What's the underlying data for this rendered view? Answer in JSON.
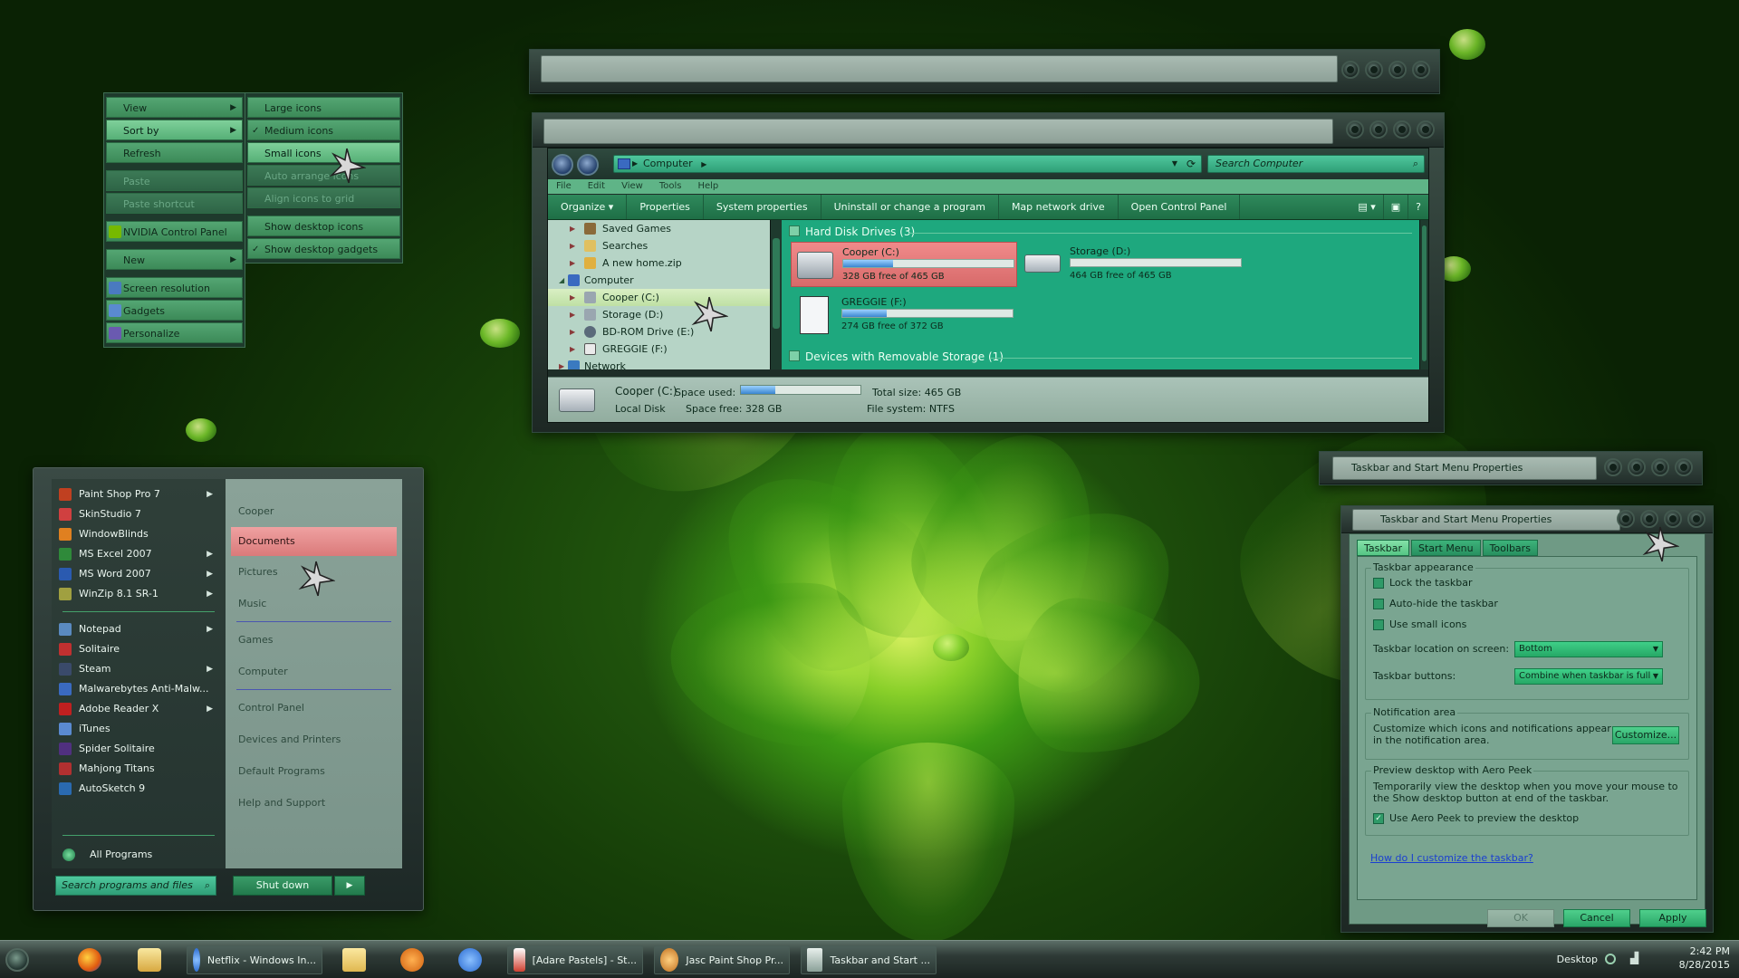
{
  "desktop": {
    "context_menu": {
      "items": [
        {
          "label": "View",
          "state": "normal",
          "submenu": true
        },
        {
          "label": "Sort by",
          "state": "hot",
          "submenu": true
        },
        {
          "label": "Refresh",
          "state": "normal"
        },
        {
          "label": "Paste",
          "state": "disabled"
        },
        {
          "label": "Paste shortcut",
          "state": "disabled"
        },
        {
          "label": "NVIDIA Control Panel",
          "state": "normal",
          "icon": "nvidia-icon"
        },
        {
          "label": "New",
          "state": "normal",
          "submenu": true
        },
        {
          "label": "Screen resolution",
          "state": "normal",
          "icon": "monitor-icon"
        },
        {
          "label": "Gadgets",
          "state": "normal",
          "icon": "gadgets-icon"
        },
        {
          "label": "Personalize",
          "state": "normal",
          "icon": "personalize-icon"
        }
      ],
      "view_submenu": [
        {
          "label": "Large icons",
          "state": "normal"
        },
        {
          "label": "Medium icons",
          "state": "normal",
          "checked": true
        },
        {
          "label": "Small icons",
          "state": "hot"
        },
        {
          "label": "Auto arrange icons",
          "state": "disabled"
        },
        {
          "label": "Align icons to grid",
          "state": "disabled"
        },
        {
          "label": "Show desktop icons",
          "state": "normal"
        },
        {
          "label": "Show desktop gadgets",
          "state": "normal",
          "checked": true
        }
      ]
    }
  },
  "explorer": {
    "address": "Computer",
    "search_placeholder": "Search Computer",
    "menu": [
      "File",
      "Edit",
      "View",
      "Tools",
      "Help"
    ],
    "commands": [
      "Organize ▾",
      "Properties",
      "System properties",
      "Uninstall or change a program",
      "Map network drive",
      "Open Control Panel"
    ],
    "tree": [
      {
        "label": "Saved Games",
        "level": 1,
        "icon": "saved-games-icon"
      },
      {
        "label": "Searches",
        "level": 1,
        "icon": "searches-icon"
      },
      {
        "label": "A new home.zip",
        "level": 1,
        "icon": "zip-icon"
      },
      {
        "label": "Computer",
        "level": 0,
        "icon": "computer-icon"
      },
      {
        "label": "Cooper (C:)",
        "level": 1,
        "icon": "drive-icon",
        "selected": true
      },
      {
        "label": "Storage (D:)",
        "level": 1,
        "icon": "drive-icon"
      },
      {
        "label": "BD-ROM Drive (E:)",
        "level": 1,
        "icon": "disc-icon"
      },
      {
        "label": "GREGGIE (F:)",
        "level": 1,
        "icon": "usb-drive-icon"
      },
      {
        "label": "Network",
        "level": 0,
        "icon": "network-icon"
      }
    ],
    "groups": {
      "hdd": "Hard Disk Drives (3)",
      "removable": "Devices with Removable Storage (1)"
    },
    "drives": [
      {
        "name": "Cooper (C:)",
        "free": "328 GB free of 465 GB",
        "used_fraction": 0.29,
        "selected": true
      },
      {
        "name": "Storage (D:)",
        "free": "464 GB free of 465 GB",
        "used_fraction": 0.0
      },
      {
        "name": "GREGGIE (F:)",
        "free": "274 GB free of 372 GB",
        "used_fraction": 0.26
      }
    ],
    "details": {
      "name": "Cooper (C:)",
      "type": "Local Disk",
      "space_used_label": "Space used:",
      "space_used_fraction": 0.29,
      "space_free": "Space free: 328 GB",
      "total_size": "Total size: 465 GB",
      "file_system": "File system: NTFS"
    }
  },
  "start_menu": {
    "programs": [
      {
        "label": "Paint Shop Pro 7",
        "submenu": true,
        "color": "#c04020"
      },
      {
        "label": "SkinStudio 7",
        "color": "#d04040"
      },
      {
        "label": "WindowBlinds",
        "color": "#e08020"
      },
      {
        "label": "MS Excel 2007",
        "submenu": true,
        "color": "#2f8a3a"
      },
      {
        "label": "MS Word 2007",
        "submenu": true,
        "color": "#2a5ab0"
      },
      {
        "label": "WinZip 8.1 SR-1",
        "submenu": true,
        "color": "#a0a040"
      }
    ],
    "programs2": [
      {
        "label": "Notepad",
        "submenu": true,
        "color": "#5a8ac0"
      },
      {
        "label": "Solitaire",
        "color": "#c03030"
      },
      {
        "label": "Steam",
        "submenu": true,
        "color": "#3a4a6a"
      },
      {
        "label": "Malwarebytes Anti-Malw...",
        "color": "#3a6ac0"
      },
      {
        "label": "Adobe Reader X",
        "submenu": true,
        "color": "#c02020"
      },
      {
        "label": "iTunes",
        "color": "#5a8ad0"
      },
      {
        "label": "Spider Solitaire",
        "color": "#503080"
      },
      {
        "label": "Mahjong Titans",
        "color": "#b03030"
      },
      {
        "label": "AutoSketch 9",
        "color": "#2a6ab0"
      }
    ],
    "all_programs": "All Programs",
    "search_placeholder": "Search programs and files",
    "shutdown": "Shut down",
    "links": [
      {
        "label": "Cooper"
      },
      {
        "label": "Documents",
        "hot": true
      },
      {
        "label": "Pictures"
      },
      {
        "label": "Music",
        "sep_after": true
      },
      {
        "label": "Games"
      },
      {
        "label": "Computer",
        "sep_after": true
      },
      {
        "label": "Control Panel"
      },
      {
        "label": "Devices and Printers"
      },
      {
        "label": "Default Programs"
      },
      {
        "label": "Help and Support"
      }
    ]
  },
  "dialog": {
    "title": "Taskbar and Start Menu Properties",
    "tabs": [
      "Taskbar",
      "Start Menu",
      "Toolbars"
    ],
    "appearance": "Taskbar appearance",
    "checks": [
      "Lock the taskbar",
      "Auto-hide the taskbar",
      "Use small icons"
    ],
    "location_label": "Taskbar location on screen:",
    "location_value": "Bottom",
    "buttons_label": "Taskbar buttons:",
    "buttons_value": "Combine when taskbar is full",
    "notif_title": "Notification area",
    "notif_text": "Customize which icons and notifications appear in the notification area.",
    "customize": "Customize...",
    "peek_title": "Preview desktop with Aero Peek",
    "peek_text": "Temporarily view the desktop when you move your mouse to the Show desktop button at end of the taskbar.",
    "peek_check": "Use Aero Peek to preview the desktop",
    "help_link": "How do I customize the taskbar?",
    "ok": "OK",
    "cancel": "Cancel",
    "apply": "Apply"
  },
  "taskbar": {
    "tasks": [
      {
        "label": "Netflix - Windows In...",
        "icon": "ie-icon",
        "color": "#2a6ad0"
      },
      {
        "label": "[Adare Pastels] - St...",
        "icon": "stylus-icon",
        "color": "#d04030"
      },
      {
        "label": "Jasc Paint Shop Pr...",
        "icon": "paintshop-icon",
        "color": "#c07020"
      },
      {
        "label": "Taskbar and Start ...",
        "icon": "taskbar-icon",
        "color": "#8aa098"
      }
    ],
    "desktop": "Desktop",
    "time": "2:42 PM",
    "date": "8/28/2015"
  }
}
